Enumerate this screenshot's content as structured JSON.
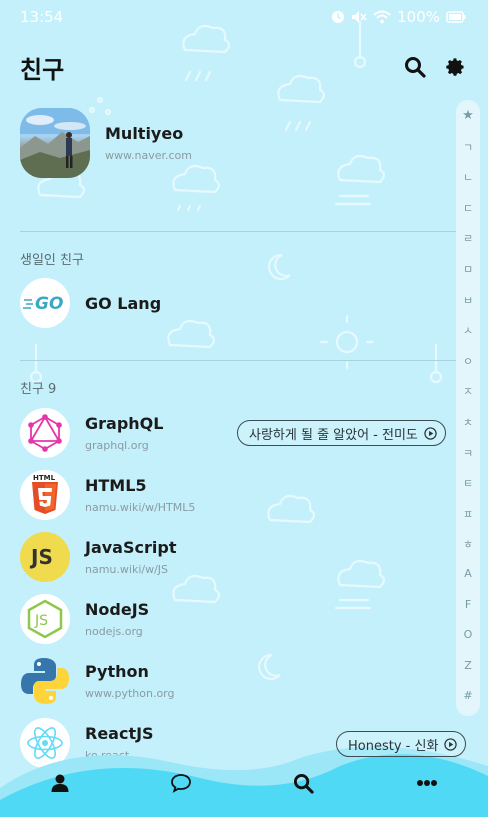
{
  "status_bar": {
    "time": "13:54",
    "battery": "100%"
  },
  "header": {
    "title": "친구"
  },
  "my_profile": {
    "name": "Multiyeo",
    "subtitle": "www.naver.com"
  },
  "sections": {
    "birthday_label": "생일인 친구",
    "friends_label": "친구 9"
  },
  "birthday_friend": {
    "name": "GO Lang",
    "logo_text": "GO"
  },
  "friends": [
    {
      "name": "GraphQL",
      "subtitle": "graphql.org",
      "icon": "graphql-logo"
    },
    {
      "name": "HTML5",
      "subtitle": "namu.wiki/w/HTML5",
      "icon": "html5-logo",
      "logo_text": "HTML"
    },
    {
      "name": "JavaScript",
      "subtitle": "namu.wiki/w/JS",
      "icon": "js-logo",
      "logo_text": "JS"
    },
    {
      "name": "NodeJS",
      "subtitle": "nodejs.org",
      "icon": "nodejs-logo",
      "logo_text": "JS"
    },
    {
      "name": "Python",
      "subtitle": "www.python.org",
      "icon": "python-logo"
    },
    {
      "name": "ReactJS",
      "subtitle": "ko.react...",
      "icon": "react-logo"
    }
  ],
  "music": [
    {
      "text": "사랑하게 될 줄 알았어 - 전미도"
    },
    {
      "text": "Honesty - 신화"
    }
  ],
  "index_bar": [
    "★",
    "ㄱ",
    "ㄴ",
    "ㄷ",
    "ㄹ",
    "ㅁ",
    "ㅂ",
    "ㅅ",
    "ㅇ",
    "ㅈ",
    "ㅊ",
    "ㅋ",
    "ㅌ",
    "ㅍ",
    "ㅎ",
    "A",
    "F",
    "O",
    "Z",
    "#"
  ],
  "colors": {
    "background": "#c4f0fb",
    "nav": "#4fd9f5",
    "accent_dark": "#111111"
  }
}
